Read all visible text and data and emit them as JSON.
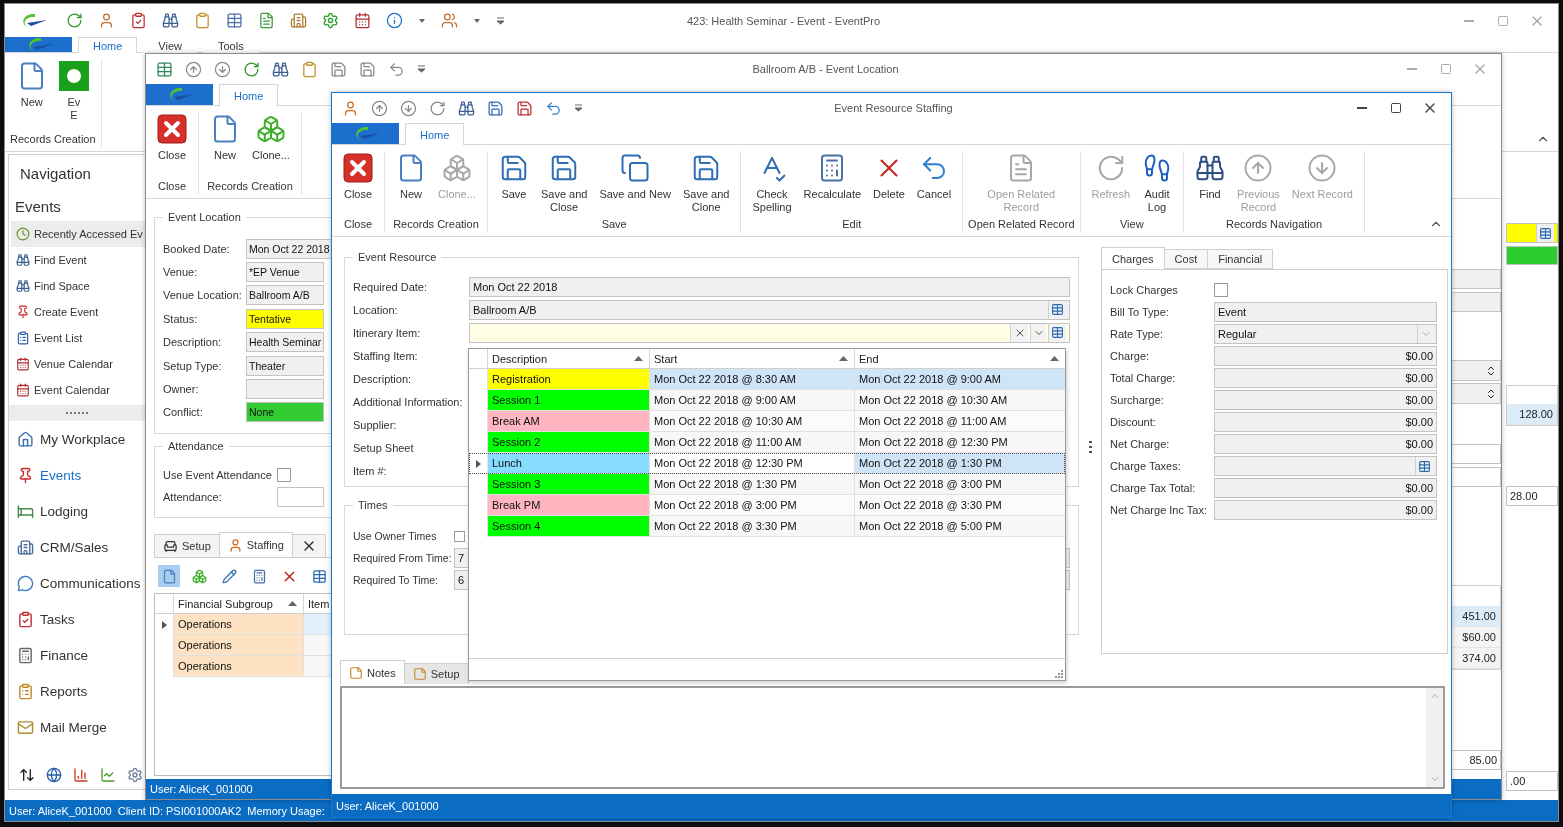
{
  "main_window": {
    "title": "423: Health Seminar - Event - EventPro",
    "ribbon_tabs": [
      {
        "label": "Home",
        "selected": true
      },
      {
        "label": "View",
        "selected": false
      },
      {
        "label": "Tools",
        "selected": false
      }
    ],
    "ribbon": {
      "buttons": [
        {
          "label": "New"
        },
        {
          "label": "Ev\nE"
        }
      ],
      "group": "Records Creation"
    },
    "navigation": {
      "title": "Navigation",
      "section": "Events",
      "items": [
        {
          "label": "Recently Accessed Ev",
          "selected": true
        },
        {
          "label": "Find Event",
          "selected": false
        },
        {
          "label": "Find Space",
          "selected": false
        },
        {
          "label": "Create Event",
          "selected": false
        },
        {
          "label": "Event List",
          "selected": false
        },
        {
          "label": "Venue Calendar",
          "selected": false
        },
        {
          "label": "Event Calendar",
          "selected": false
        }
      ],
      "modules": [
        {
          "label": "My Workplace",
          "selected": false
        },
        {
          "label": "Events",
          "selected": true
        },
        {
          "label": "Lodging",
          "selected": false
        },
        {
          "label": "CRM/Sales",
          "selected": false
        },
        {
          "label": "Communications",
          "selected": false
        },
        {
          "label": "Tasks",
          "selected": false
        },
        {
          "label": "Finance",
          "selected": false
        },
        {
          "label": "Reports",
          "selected": false
        },
        {
          "label": "Mail Merge",
          "selected": false
        }
      ]
    },
    "right_values": [
      {
        "value": "128.00",
        "selected": true
      },
      {
        "value": "28.00",
        "selected": false
      },
      {
        "value": ".00",
        "selected": false
      }
    ],
    "status_bar": [
      "User: AliceK_001000",
      "Client ID: PSI001000AK2",
      "Memory Usage:"
    ]
  },
  "location_window": {
    "title": "Ballroom A/B - Event Location",
    "ribbon_tabs": [
      {
        "label": "Home",
        "selected": true
      }
    ],
    "ribbon_groups": [
      {
        "label": "Close",
        "buttons": [
          {
            "label": "Close",
            "disabled": false
          }
        ]
      },
      {
        "label": "Records Creation",
        "buttons": [
          {
            "label": "New",
            "disabled": false
          },
          {
            "label": "Clone...",
            "disabled": false
          }
        ]
      }
    ],
    "event_location": {
      "title": "Event Location",
      "fields": [
        {
          "label": "Booked Date:",
          "value": "Mon Oct 22 2018"
        },
        {
          "label": "Venue:",
          "value": "*EP Venue"
        },
        {
          "label": "Venue Location:",
          "value": "Ballroom A/B"
        },
        {
          "label": "Status:",
          "value": "Tentative",
          "color": "#ffff00"
        },
        {
          "label": "Description:",
          "value": "Health Seminar"
        },
        {
          "label": "Setup Type:",
          "value": "Theater"
        },
        {
          "label": "Owner:"
        },
        {
          "label": "Conflict:",
          "value": "None",
          "color": "#33cc33"
        }
      ]
    },
    "attendance": {
      "title": "Attendance",
      "use_label": "Use Event Attendance",
      "use_checked": false,
      "attendance_label": "Attendance:"
    },
    "detail_tabs": [
      {
        "label": "Setup",
        "selected": false
      },
      {
        "label": "Staffing",
        "selected": true
      },
      {
        "selected": false
      }
    ],
    "grid": {
      "columns": [
        {
          "label": "Financial Subgroup"
        },
        {
          "label": "Item"
        }
      ],
      "rows": [
        {
          "financial_subgroup": "Operations",
          "color": "#fde3c4",
          "selected": true
        },
        {
          "financial_subgroup": "Operations",
          "color": "#fde3c4",
          "selected": false
        },
        {
          "financial_subgroup": "Operations",
          "color": "#fde3c4",
          "selected": false
        }
      ]
    },
    "right_values": [
      {
        "value": "451.00",
        "selected": true
      },
      {
        "value": "$60.00",
        "selected": false
      },
      {
        "value": "374.00",
        "selected": false
      }
    ],
    "right_total": "85.00",
    "status_bar": "User: AliceK_001000"
  },
  "staffing_window": {
    "title": "Event Resource Staffing",
    "ribbon_tabs": [
      {
        "label": "Home",
        "selected": true
      }
    ],
    "ribbon_groups": [
      {
        "label": "Close",
        "buttons": [
          {
            "label": "Close",
            "disabled": false
          }
        ]
      },
      {
        "label": "Records Creation",
        "buttons": [
          {
            "label": "New",
            "disabled": false
          },
          {
            "label": "Clone...",
            "disabled": true
          }
        ]
      },
      {
        "label": "Save",
        "buttons": [
          {
            "label": "Save",
            "disabled": false
          },
          {
            "label": "Save and\nClose",
            "disabled": false
          },
          {
            "label": "Save and New",
            "disabled": false
          },
          {
            "label": "Save and\nClone",
            "disabled": false
          }
        ]
      },
      {
        "label": "Edit",
        "buttons": [
          {
            "label": "Check\nSpelling",
            "disabled": false
          },
          {
            "label": "Recalculate",
            "disabled": false
          },
          {
            "label": "Delete",
            "disabled": false
          },
          {
            "label": "Cancel",
            "disabled": false
          }
        ]
      },
      {
        "label": "Open Related Record",
        "buttons": [
          {
            "label": "Open Related\nRecord",
            "disabled": true
          }
        ]
      },
      {
        "label": "View",
        "buttons": [
          {
            "label": "Refresh",
            "disabled": true
          },
          {
            "label": "Audit\nLog",
            "disabled": false
          }
        ]
      },
      {
        "label": "Records Navigation",
        "buttons": [
          {
            "label": "Find",
            "disabled": false
          },
          {
            "label": "Previous\nRecord",
            "disabled": true
          },
          {
            "label": "Next Record",
            "disabled": true
          }
        ]
      }
    ],
    "event_resource": {
      "title": "Event Resource",
      "fields": [
        {
          "label": "Required Date:",
          "kind": "text",
          "value": "Mon Oct 22 2018"
        },
        {
          "label": "Location:",
          "kind": "lookup",
          "value": "Ballroom A/B"
        },
        {
          "label": "Itinerary Item:",
          "kind": "combo"
        },
        {
          "label": "Staffing Item:"
        },
        {
          "label": "Description:"
        },
        {
          "label": "Additional Information:"
        },
        {
          "label": "Supplier:"
        },
        {
          "label": "Setup Sheet"
        },
        {
          "label": "Item #:"
        }
      ]
    },
    "itinerary_list": {
      "columns": [
        {
          "label": "Description"
        },
        {
          "label": "Start"
        },
        {
          "label": "End"
        }
      ],
      "rows": [
        {
          "description": "Registration",
          "start": "Mon Oct 22 2018 @ 8:30 AM",
          "end": "Mon Oct 22 2018 @ 9:00 AM",
          "color": "#ffff00",
          "hovered": true,
          "selected": false
        },
        {
          "description": "Session 1",
          "start": "Mon Oct 22 2018 @ 9:00 AM",
          "end": "Mon Oct 22 2018 @ 10:30 AM",
          "color": "#00ff00",
          "hovered": false,
          "selected": false
        },
        {
          "description": "Break AM",
          "start": "Mon Oct 22 2018 @ 10:30 AM",
          "end": "Mon Oct 22 2018 @ 11:00 AM",
          "color": "#ffb6c1",
          "hovered": false,
          "selected": false
        },
        {
          "description": "Session 2",
          "start": "Mon Oct 22 2018 @ 11:00 AM",
          "end": "Mon Oct 22 2018 @ 12:30 PM",
          "color": "#00ff00",
          "hovered": false,
          "selected": false
        },
        {
          "description": "Lunch",
          "start": "Mon Oct 22 2018 @ 12:30 PM",
          "end": "Mon Oct 22 2018 @ 1:30 PM",
          "color": "#87dcff",
          "hovered": false,
          "selected": true
        },
        {
          "description": "Session 3",
          "start": "Mon Oct 22 2018 @ 1:30 PM",
          "end": "Mon Oct 22 2018 @ 3:00 PM",
          "color": "#00ff00",
          "hovered": false,
          "selected": false
        },
        {
          "description": "Break PM",
          "start": "Mon Oct 22 2018 @ 3:00 PM",
          "end": "Mon Oct 22 2018 @ 3:30 PM",
          "color": "#ffb6c1",
          "hovered": false,
          "selected": false
        },
        {
          "description": "Session 4",
          "start": "Mon Oct 22 2018 @ 3:30 PM",
          "end": "Mon Oct 22 2018 @ 5:00 PM",
          "color": "#00ff00",
          "hovered": false,
          "selected": false
        }
      ]
    },
    "times": {
      "title": "Times",
      "fields": [
        {
          "label": "Use Owner Times",
          "kind": "checkbox",
          "checked": false
        },
        {
          "label": "Required From Time:",
          "kind": "text",
          "value": "7"
        },
        {
          "label": "Required To Time:",
          "kind": "text",
          "value": "6"
        }
      ]
    },
    "charges": {
      "tabs": [
        {
          "label": "Charges",
          "selected": true
        },
        {
          "label": "Cost",
          "selected": false
        },
        {
          "label": "Financial",
          "selected": false
        }
      ],
      "fields": [
        {
          "label": "Lock Charges",
          "kind": "checkbox",
          "checked": false
        },
        {
          "label": "Bill To Type:",
          "kind": "text",
          "value": "Event"
        },
        {
          "label": "Rate Type:",
          "kind": "dropdown",
          "value": "Regular"
        },
        {
          "label": "Charge:",
          "kind": "money",
          "value": "$0.00"
        },
        {
          "label": "Total Charge:",
          "kind": "money",
          "value": "$0.00"
        },
        {
          "label": "Surcharge:",
          "kind": "money",
          "value": "$0.00"
        },
        {
          "label": "Discount:",
          "kind": "money",
          "value": "$0.00"
        },
        {
          "label": "Net Charge:",
          "kind": "money",
          "value": "$0.00"
        },
        {
          "label": "Charge Taxes:",
          "kind": "lookup"
        },
        {
          "label": "Charge Tax Total:",
          "kind": "money",
          "value": "$0.00"
        },
        {
          "label": "Net Charge Inc Tax:",
          "kind": "money",
          "value": "$0.00"
        }
      ]
    },
    "bottom_tabs": [
      {
        "label": "Notes",
        "selected": true
      },
      {
        "label": "Setup",
        "selected": false
      }
    ],
    "status_bar": "User: AliceK_001000"
  }
}
